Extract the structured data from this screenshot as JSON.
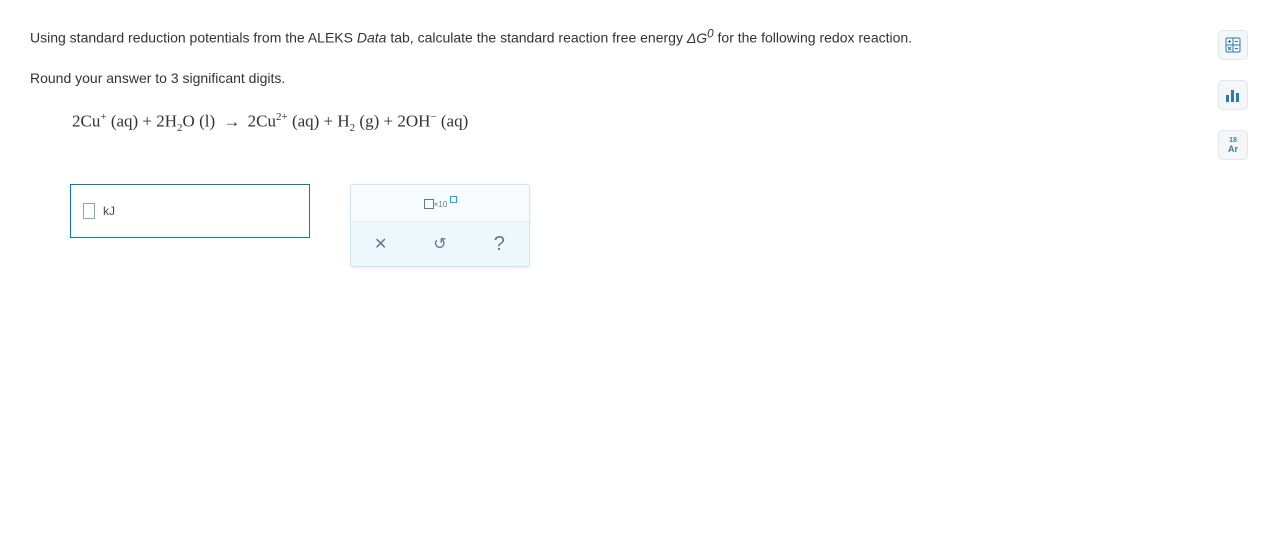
{
  "question": {
    "line1_a": "Using standard reduction potentials from the ALEKS ",
    "line1_data": "Data",
    "line1_b": " tab, calculate the standard reaction free energy ",
    "line1_c": " for the following redox reaction.",
    "line2": "Round your answer to 3 significant digits.",
    "deltaG": "ΔG",
    "supzero": "0"
  },
  "equation": {
    "p1": "2Cu",
    "sup1": "+",
    "p2": " (aq) + 2H",
    "sub2": "2",
    "p3": "O (l) ",
    "arrow": "→",
    "p4": " 2Cu",
    "sup4": "2+",
    "p5": " (aq) + H",
    "sub5": "2",
    "p6": " (g) + 2OH",
    "sup6": "−",
    "p7": " (aq)"
  },
  "answer": {
    "unit": "kJ",
    "value": ""
  },
  "pad": {
    "sci_x10": "×10"
  },
  "tools": {
    "calc": "calculator",
    "bar": "bar-chart",
    "pt_num": "18",
    "pt_sym": "Ar"
  }
}
